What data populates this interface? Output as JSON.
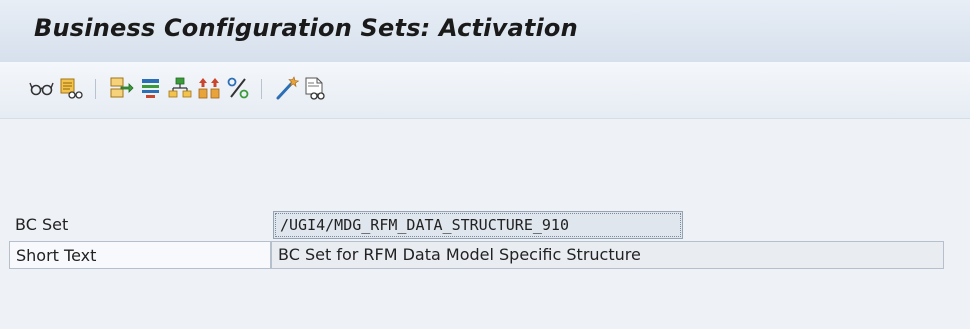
{
  "window": {
    "title": "Business Configuration Sets: Activation"
  },
  "toolbar": {
    "icons": [
      "glasses-icon",
      "display-details-icon",
      "transfer-icon",
      "list-icon",
      "hierarchy-icon",
      "sort-icon",
      "percent-icon",
      "magic-wand-icon",
      "display-document-icon"
    ]
  },
  "form": {
    "bc_set": {
      "label": "BC Set",
      "value": "/UGI4/MDG_RFM_DATA_STRUCTURE_910"
    },
    "short_text": {
      "label": "Short Text",
      "value": "BC Set for RFM Data Model Specific Structure"
    }
  },
  "colors": {
    "title_bar": "#dbe3ee",
    "background": "#eef2f7",
    "toolbar_orange": "#e8a33a",
    "toolbar_green": "#3c9a3c",
    "toolbar_blue": "#2d6fb5",
    "toolbar_red": "#c8452e"
  }
}
